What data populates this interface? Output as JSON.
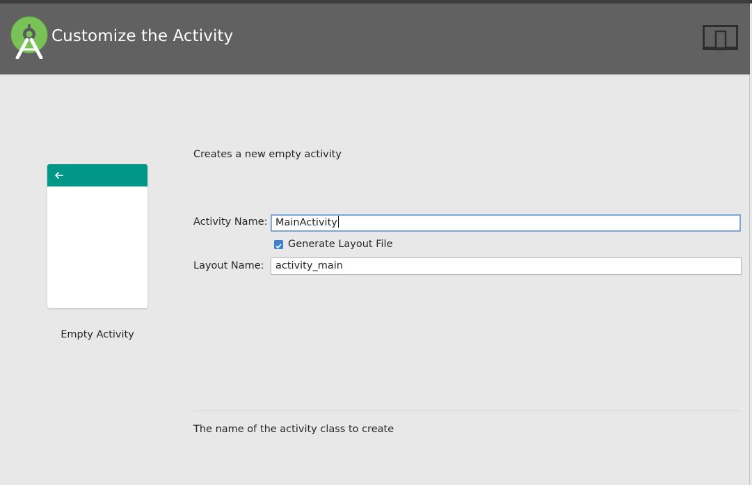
{
  "header": {
    "title": "Customize the Activity"
  },
  "template": {
    "name": "Empty Activity",
    "toolbar_color": "#009688",
    "back_icon": "arrow-left-icon"
  },
  "form": {
    "description": "Creates a new empty activity",
    "activity_name": {
      "label": "Activity Name:",
      "value": "MainActivity"
    },
    "generate_layout": {
      "label": "Generate Layout File",
      "checked": true
    },
    "layout_name": {
      "label": "Layout Name:",
      "value": "activity_main"
    }
  },
  "help_text": "The name of the activity class to create",
  "colors": {
    "header_bg": "#616161",
    "android_green": "#78c257",
    "focus_border": "#7ba7dc",
    "checkbox": "#3d7fd1"
  }
}
